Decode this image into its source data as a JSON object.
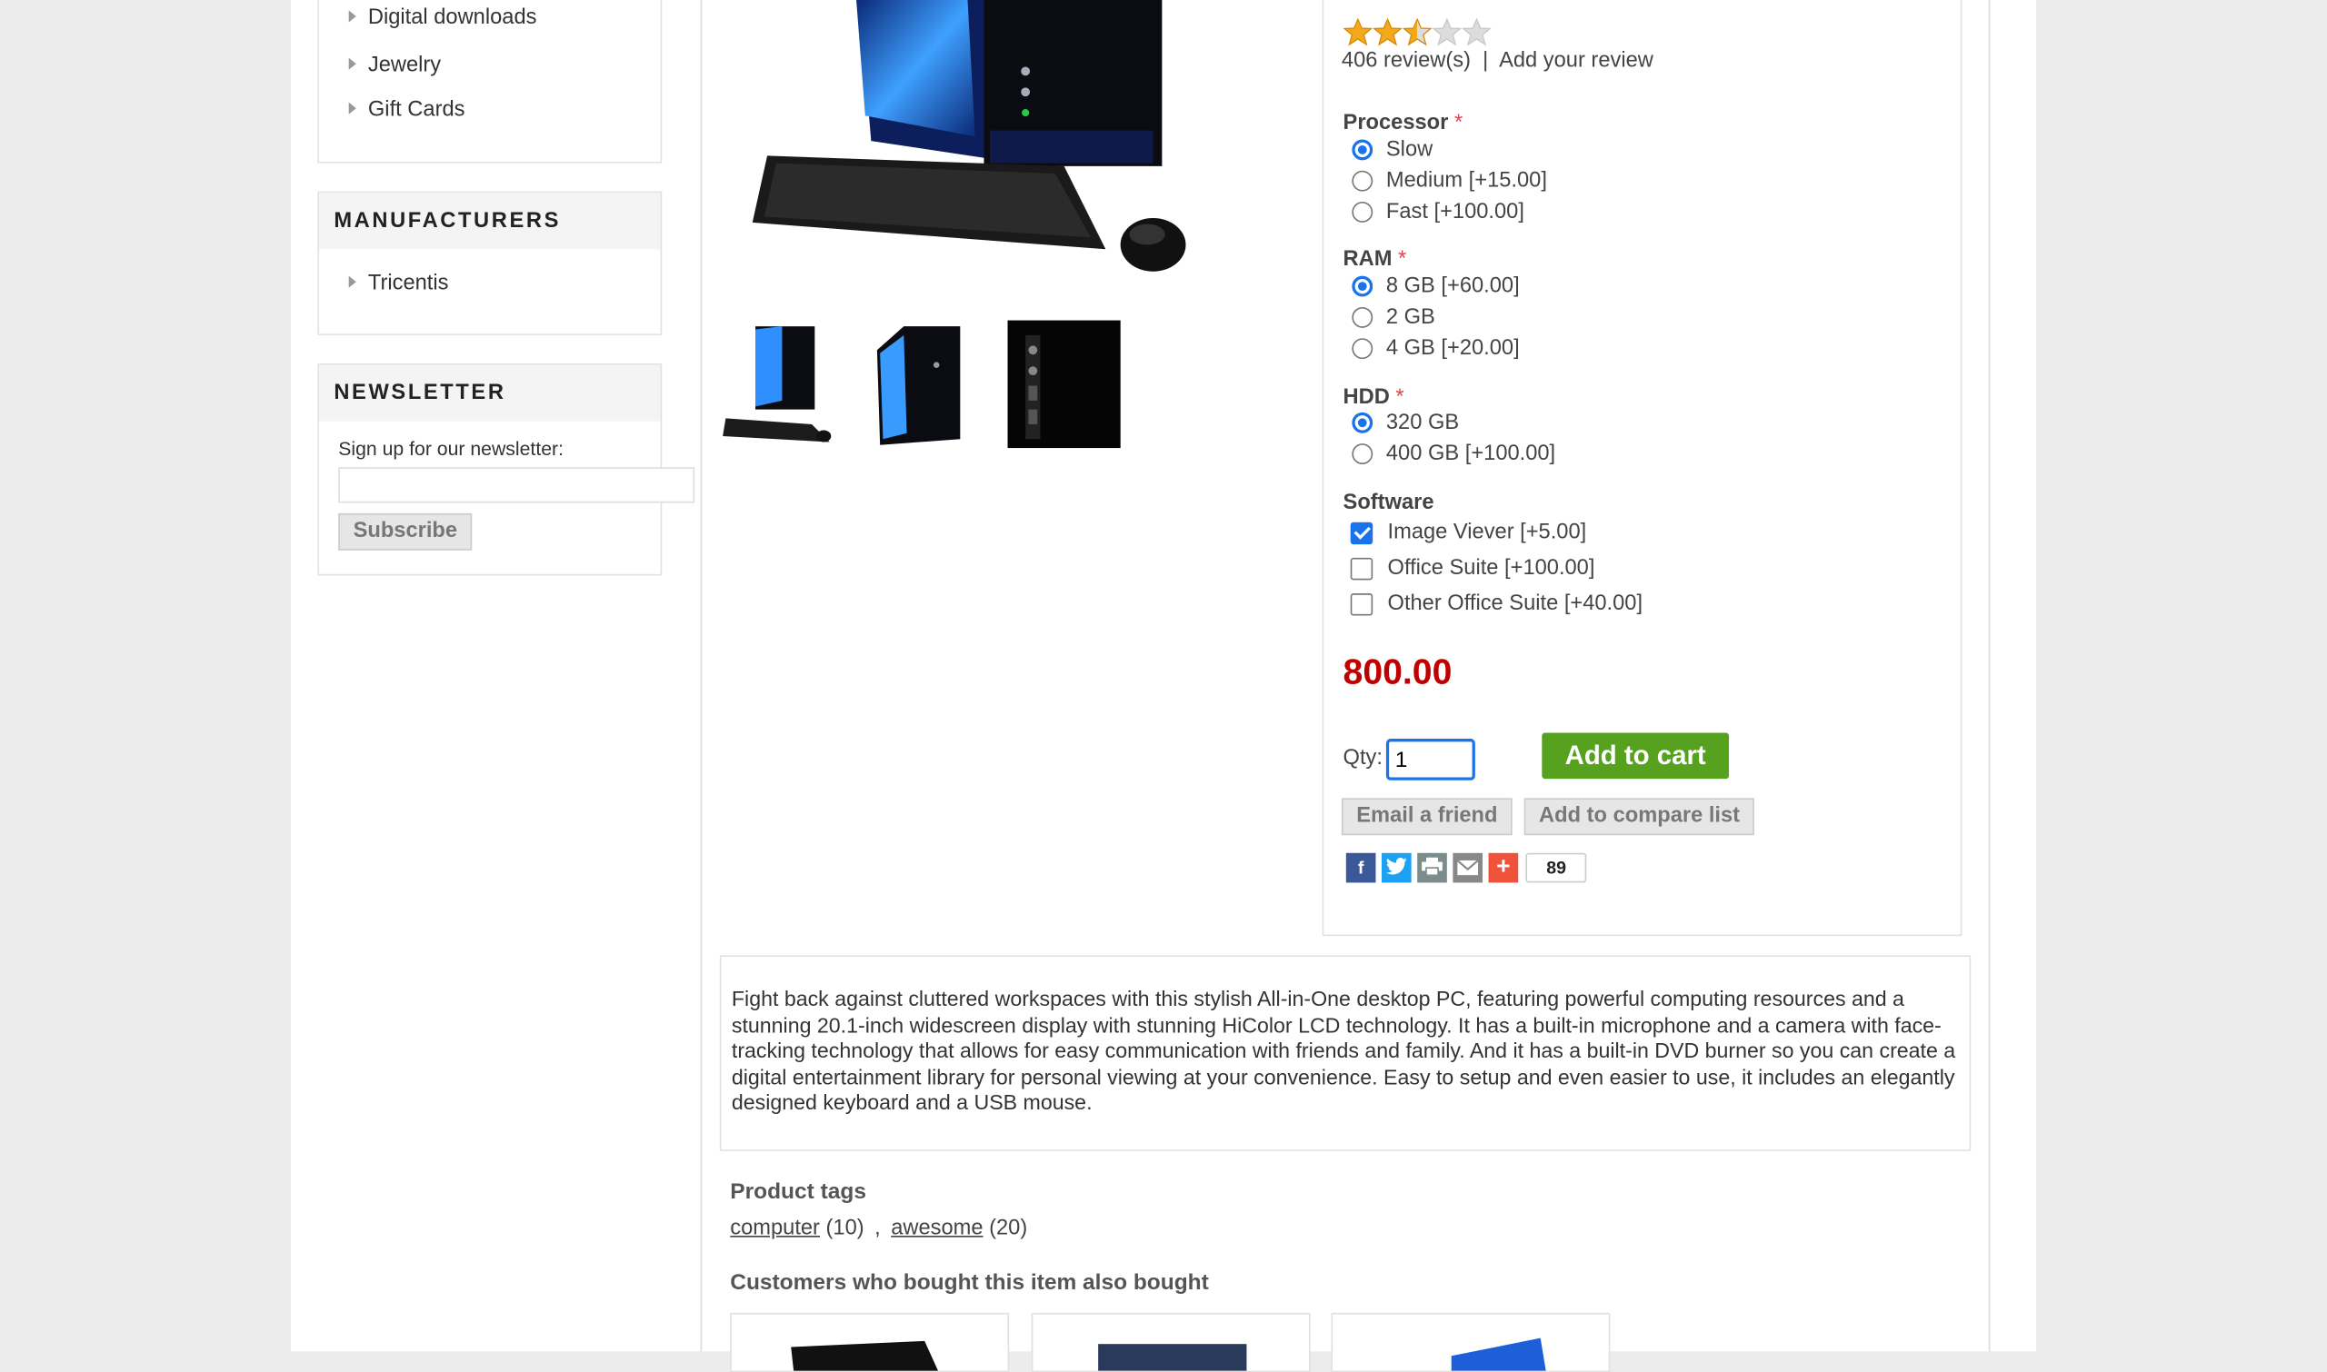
{
  "sidebar": {
    "categories": [
      "Digital downloads",
      "Jewelry",
      "Gift Cards"
    ],
    "manufacturers_title": "MANUFACTURERS",
    "manufacturers": [
      "Tricentis"
    ],
    "newsletter_title": "NEWSLETTER",
    "newsletter_label": "Sign up for our newsletter:",
    "subscribe_label": "Subscribe"
  },
  "product": {
    "rating": 2.5,
    "reviews_text": "406 review(s)",
    "review_sep": "|",
    "add_review": "Add your review",
    "price": "800.00",
    "qty_label": "Qty:",
    "qty_value": "1",
    "add_to_cart": "Add to cart",
    "email_friend": "Email a friend",
    "add_compare": "Add to compare list",
    "share_count": "89",
    "description": "Fight back against cluttered workspaces with this stylish All-in-One desktop PC, featuring powerful computing resources and a stunning 20.1-inch widescreen display with stunning HiColor LCD technology. It has a built-in microphone and a camera with face-tracking technology that allows for easy communication with friends and family. And it has a built-in DVD burner so you can create a digital entertainment library for personal viewing at your convenience. Easy to setup and even easier to use, it includes an elegantly designed keyboard and a USB mouse."
  },
  "options": {
    "processor": {
      "title": "Processor",
      "req": "*",
      "items": [
        "Slow",
        "Medium [+15.00]",
        "Fast [+100.00]"
      ],
      "selected": 0
    },
    "ram": {
      "title": "RAM",
      "req": "*",
      "items": [
        "8 GB [+60.00]",
        "2 GB",
        "4 GB [+20.00]"
      ],
      "selected": 0
    },
    "hdd": {
      "title": "HDD",
      "req": "*",
      "items": [
        "320 GB",
        "400 GB [+100.00]"
      ],
      "selected": 0
    },
    "software": {
      "title": "Software",
      "items": [
        "Image Viever [+5.00]",
        "Office Suite [+100.00]",
        "Other Office Suite [+40.00]"
      ],
      "checked": [
        true,
        false,
        false
      ]
    }
  },
  "tags": {
    "title": "Product tags",
    "items": [
      {
        "name": "computer",
        "count": "(10)"
      },
      {
        "name": "awesome",
        "count": "(20)"
      }
    ],
    "separator": ","
  },
  "also_bought_title": "Customers who bought this item also bought",
  "colors": {
    "price": "#c00000",
    "cart_green": "#56a11e",
    "radio_blue": "#1a73e8",
    "facebook": "#3b5998",
    "twitter": "#1da1f2",
    "print": "#7b8c8c",
    "email": "#888888",
    "plus": "#f0533c"
  }
}
